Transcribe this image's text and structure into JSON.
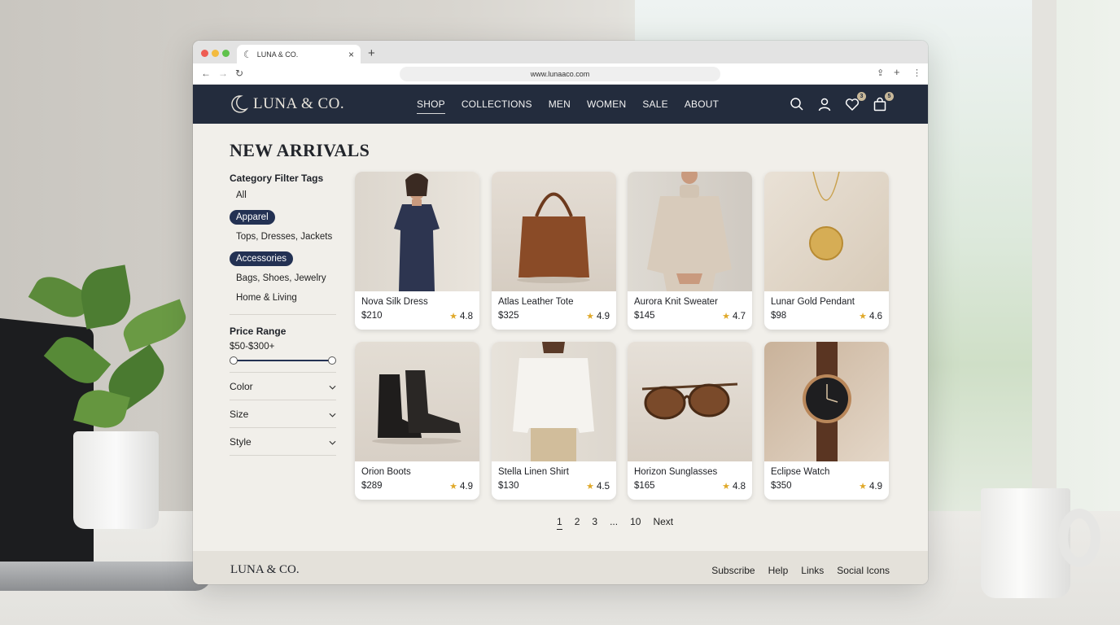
{
  "browser": {
    "tab_title": "LUNA & CO.",
    "url": "www.lunaaco.com"
  },
  "header": {
    "logo": "LUNA & CO.",
    "nav": [
      "SHOP",
      "COLLECTIONS",
      "MEN",
      "WOMEN",
      "SALE",
      "ABOUT"
    ],
    "active_nav": "SHOP",
    "wishlist_count": "3",
    "cart_count": "5",
    "icons": [
      "search-icon",
      "account-icon",
      "heart-icon",
      "bag-icon"
    ]
  },
  "page": {
    "title": "NEW ARRIVALS"
  },
  "filters": {
    "category_heading": "Category Filter Tags",
    "tags": [
      "All",
      "Apparel",
      "Tops, Dresses, Jackets",
      "Accessories",
      "Bags, Shoes, Jewelry",
      "Home & Living"
    ],
    "price_heading": "Price Range",
    "price_value": "$50-$300+",
    "accordions": [
      "Color",
      "Size",
      "Style"
    ]
  },
  "products": [
    {
      "name": "Nova Silk Dress",
      "price": "$210",
      "rating": "4.8"
    },
    {
      "name": "Atlas Leather Tote",
      "price": "$325",
      "rating": "4.9"
    },
    {
      "name": "Aurora Knit Sweater",
      "price": "$145",
      "rating": "4.7"
    },
    {
      "name": "Lunar Gold Pendant",
      "price": "$98",
      "rating": "4.6"
    },
    {
      "name": "Orion Boots",
      "price": "$289",
      "rating": "4.9"
    },
    {
      "name": "Stella Linen Shirt",
      "price": "$130",
      "rating": "4.5"
    },
    {
      "name": "Horizon Sunglasses",
      "price": "$165",
      "rating": "4.8"
    },
    {
      "name": "Eclipse Watch",
      "price": "$350",
      "rating": "4.9"
    }
  ],
  "pagination": [
    "1",
    "2",
    "3",
    "...",
    "10",
    "Next"
  ],
  "footer": {
    "logo": "LUNA & CO.",
    "links": [
      "Subscribe",
      "Help",
      "Links",
      "Social Icons"
    ]
  },
  "colors": {
    "header_bg": "#232c3d",
    "pill_bg": "#233153",
    "page_bg": "#f1efea",
    "star": "#e0a92a"
  }
}
